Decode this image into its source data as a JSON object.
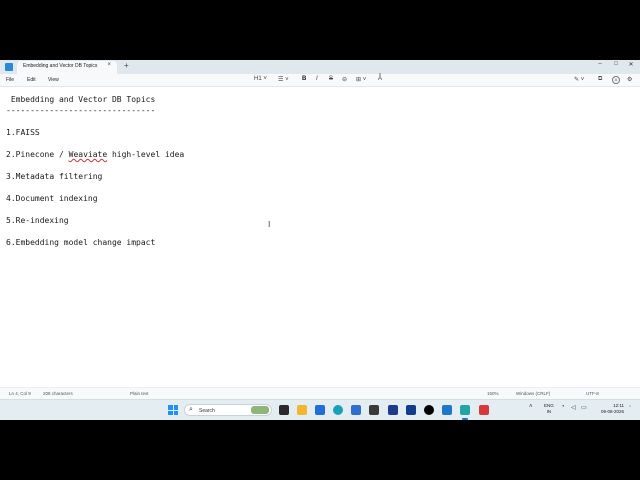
{
  "window": {
    "tab_title": "Embedding and Vector DB Topics",
    "tab_close": "×",
    "new_tab": "+",
    "minimize": "–",
    "maximize": "□",
    "close": "✕"
  },
  "menu": {
    "file": "File",
    "edit": "Edit",
    "view": "View"
  },
  "toolbar": {
    "heading": "H1",
    "bold": "B",
    "italic": "I",
    "strikethrough": "S",
    "clear": "Aͦ"
  },
  "document": {
    "lines": [
      " Embedding and Vector DB Topics",
      "-------------------------------",
      "",
      "1.FAISS",
      "",
      "2.Pinecone / ",
      "",
      "3.Metadata filtering",
      "",
      "4.Document indexing",
      "",
      "5.Re-indexing",
      "",
      "6.Embedding model change impact"
    ],
    "line2_misspelled": "Weaviate",
    "line2_rest": " high-level idea"
  },
  "statusbar": {
    "position": "Ln 4, Col 9",
    "characters": "208 characters",
    "format": "Plain text",
    "zoom": "150%",
    "line_ending": "Windows (CRLF)",
    "encoding": "UTF-8"
  },
  "taskbar": {
    "search_placeholder": "Search",
    "language_1": "ENG",
    "language_2": "IN",
    "time": "12:11",
    "date": "09-08-2026"
  },
  "colors": {
    "accent": "#1e90ff",
    "spellcheck": "#d13438",
    "titlebar": "#dfe8ec",
    "taskbar": "#e4eef2"
  }
}
